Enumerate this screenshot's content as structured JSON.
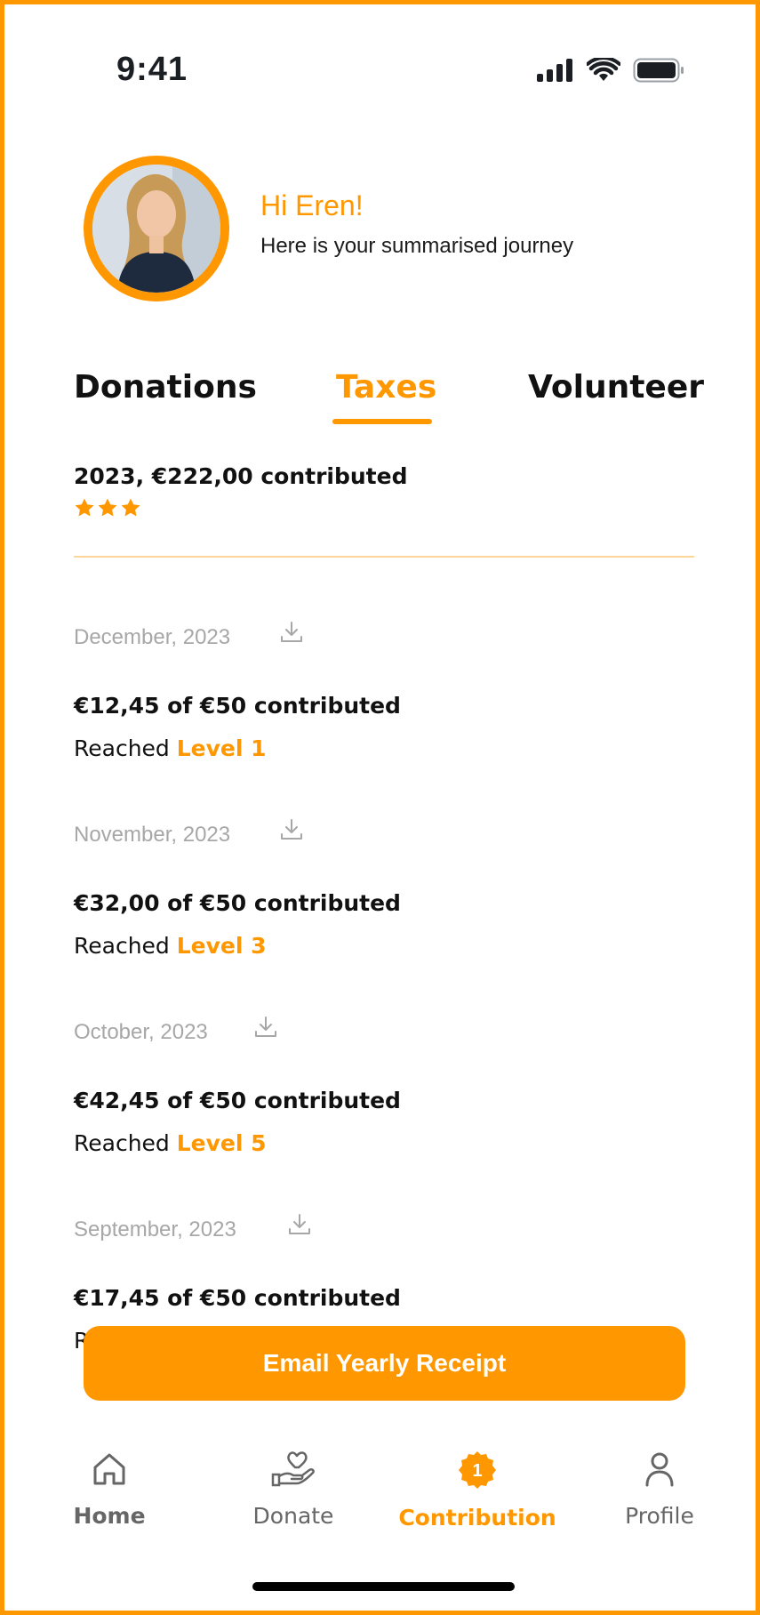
{
  "status_bar": {
    "time": "9:41"
  },
  "header": {
    "greeting": "Hi Eren!",
    "subtitle": "Here is your summarised journey"
  },
  "tabs": [
    {
      "label": "Donations",
      "active": false
    },
    {
      "label": "Taxes",
      "active": true
    },
    {
      "label": "Volunteer",
      "active": false
    }
  ],
  "summary": {
    "text": "2023, €222,00 contributed",
    "stars": 3
  },
  "entries": [
    {
      "month": "December, 2023",
      "amount": "€12,45 of €50 contributed",
      "reached_prefix": "Reached ",
      "level": "Level 1"
    },
    {
      "month": "November, 2023",
      "amount": "€32,00 of €50 contributed",
      "reached_prefix": "Reached ",
      "level": "Level 3"
    },
    {
      "month": "October, 2023",
      "amount": "€42,45 of €50 contributed",
      "reached_prefix": "Reached ",
      "level": "Level 5"
    },
    {
      "month": "September, 2023",
      "amount": "€17,45 of €50 contributed",
      "reached_prefix": "R",
      "level": ""
    }
  ],
  "cta": {
    "label": "Email Yearly Receipt"
  },
  "nav": [
    {
      "label": "Home",
      "icon": "home-icon"
    },
    {
      "label": "Donate",
      "icon": "donate-hand-heart-icon"
    },
    {
      "label": "Contribution",
      "icon": "badge-icon",
      "active": true,
      "badge": "1"
    },
    {
      "label": "Profile",
      "icon": "profile-icon"
    }
  ],
  "colors": {
    "accent": "#FF9800",
    "muted": "#a7a7a7",
    "text": "#111111"
  }
}
